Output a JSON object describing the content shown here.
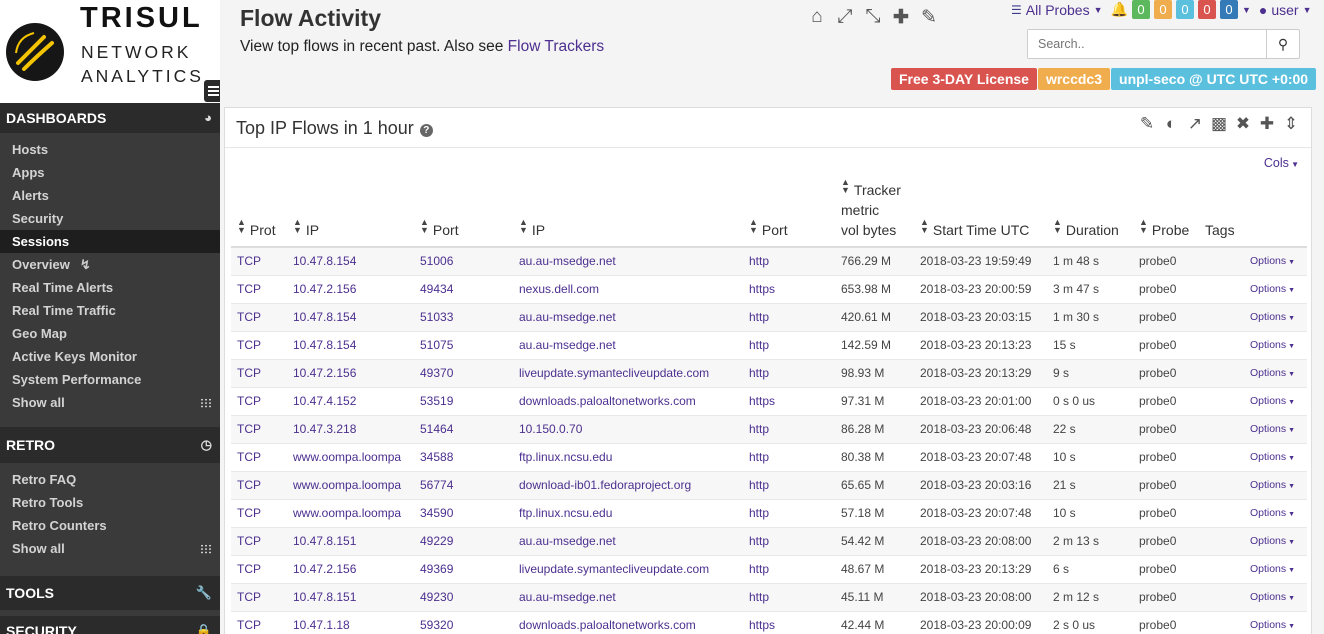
{
  "brand": {
    "name": "TRISUL",
    "line1": "NETWORK",
    "line2": "ANALYTICS"
  },
  "sidebar": {
    "dashboards": {
      "title": "DASHBOARDS",
      "items": [
        {
          "label": "Hosts"
        },
        {
          "label": "Apps"
        },
        {
          "label": "Alerts"
        },
        {
          "label": "Security"
        },
        {
          "label": "Sessions",
          "active": true
        },
        {
          "label": "Overview"
        },
        {
          "label": "Real Time Alerts"
        },
        {
          "label": "Real Time Traffic"
        },
        {
          "label": "Geo Map"
        },
        {
          "label": "Active Keys Monitor"
        },
        {
          "label": "System Performance"
        },
        {
          "label": "Show all"
        }
      ]
    },
    "retro": {
      "title": "RETRO",
      "items": [
        {
          "label": "Retro FAQ"
        },
        {
          "label": "Retro Tools"
        },
        {
          "label": "Retro Counters"
        },
        {
          "label": "Show all"
        }
      ]
    },
    "tools": {
      "title": "TOOLS"
    },
    "security": {
      "title": "SECURITY"
    }
  },
  "header": {
    "title": "Flow Activity",
    "subtitle": "View top flows in recent past. Also see",
    "subtitle_link": "Flow Trackers"
  },
  "topbar": {
    "probes_label": "All Probes",
    "counts": [
      {
        "value": "0",
        "color": "#5cb85c"
      },
      {
        "value": "0",
        "color": "#f0ad4e"
      },
      {
        "value": "0",
        "color": "#5bc0de"
      },
      {
        "value": "0",
        "color": "#d9534f"
      },
      {
        "value": "0",
        "color": "#337ab7"
      }
    ],
    "user_label": "user",
    "search_placeholder": "Search.."
  },
  "labels": [
    {
      "text": "Free 3-DAY License",
      "color": "#d9534f"
    },
    {
      "text": "wrccdc3",
      "color": "#f0ad4e"
    },
    {
      "text": "unpl-seco @ UTC UTC +0:00",
      "color": "#5bc0de"
    }
  ],
  "panel": {
    "title": "Top IP Flows in 1 hour",
    "cols_label": "Cols",
    "columns": {
      "prot": "Prot",
      "ip1": "IP",
      "port1": "Port",
      "ip2": "IP",
      "port2": "Port",
      "tracker1": "Tracker",
      "tracker2": "metric",
      "tracker3": "vol bytes",
      "start": "Start Time UTC",
      "duration": "Duration",
      "probe": "Probe",
      "tags": "Tags"
    },
    "rows": [
      {
        "prot": "TCP",
        "ip1": "10.47.8.154",
        "port1": "51006",
        "ip2": "au.au-msedge.net",
        "port2": "http",
        "tracker": "766.29 M",
        "start": "2018-03-23 19:59:49",
        "duration": "1 m 48 s",
        "probe": "probe0",
        "options": "Options"
      },
      {
        "prot": "TCP",
        "ip1": "10.47.2.156",
        "port1": "49434",
        "ip2": "nexus.dell.com",
        "port2": "https",
        "tracker": "653.98 M",
        "start": "2018-03-23 20:00:59",
        "duration": "3 m 47 s",
        "probe": "probe0",
        "options": "Options"
      },
      {
        "prot": "TCP",
        "ip1": "10.47.8.154",
        "port1": "51033",
        "ip2": "au.au-msedge.net",
        "port2": "http",
        "tracker": "420.61 M",
        "start": "2018-03-23 20:03:15",
        "duration": "1 m 30 s",
        "probe": "probe0",
        "options": "Options"
      },
      {
        "prot": "TCP",
        "ip1": "10.47.8.154",
        "port1": "51075",
        "ip2": "au.au-msedge.net",
        "port2": "http",
        "tracker": "142.59 M",
        "start": "2018-03-23 20:13:23",
        "duration": "15 s",
        "probe": "probe0",
        "options": "Options"
      },
      {
        "prot": "TCP",
        "ip1": "10.47.2.156",
        "port1": "49370",
        "ip2": "liveupdate.symantecliveupdate.com",
        "port2": "http",
        "tracker": "98.93 M",
        "start": "2018-03-23 20:13:29",
        "duration": "9 s",
        "probe": "probe0",
        "options": "Options"
      },
      {
        "prot": "TCP",
        "ip1": "10.47.4.152",
        "port1": "53519",
        "ip2": "downloads.paloaltonetworks.com",
        "port2": "https",
        "tracker": "97.31 M",
        "start": "2018-03-23 20:01:00",
        "duration": "0 s 0 us",
        "probe": "probe0",
        "options": "Options"
      },
      {
        "prot": "TCP",
        "ip1": "10.47.3.218",
        "port1": "51464",
        "ip2": "10.150.0.70",
        "port2": "http",
        "tracker": "86.28 M",
        "start": "2018-03-23 20:06:48",
        "duration": "22 s",
        "probe": "probe0",
        "options": "Options"
      },
      {
        "prot": "TCP",
        "ip1": "www.oompa.loompa",
        "port1": "34588",
        "ip2": "ftp.linux.ncsu.edu",
        "port2": "http",
        "tracker": "80.38 M",
        "start": "2018-03-23 20:07:48",
        "duration": "10 s",
        "probe": "probe0",
        "options": "Options"
      },
      {
        "prot": "TCP",
        "ip1": "www.oompa.loompa",
        "port1": "56774",
        "ip2": "download-ib01.fedoraproject.org",
        "port2": "http",
        "tracker": "65.65 M",
        "start": "2018-03-23 20:03:16",
        "duration": "21 s",
        "probe": "probe0",
        "options": "Options"
      },
      {
        "prot": "TCP",
        "ip1": "www.oompa.loompa",
        "port1": "34590",
        "ip2": "ftp.linux.ncsu.edu",
        "port2": "http",
        "tracker": "57.18 M",
        "start": "2018-03-23 20:07:48",
        "duration": "10 s",
        "probe": "probe0",
        "options": "Options"
      },
      {
        "prot": "TCP",
        "ip1": "10.47.8.151",
        "port1": "49229",
        "ip2": "au.au-msedge.net",
        "port2": "http",
        "tracker": "54.42 M",
        "start": "2018-03-23 20:08:00",
        "duration": "2 m 13 s",
        "probe": "probe0",
        "options": "Options"
      },
      {
        "prot": "TCP",
        "ip1": "10.47.2.156",
        "port1": "49369",
        "ip2": "liveupdate.symantecliveupdate.com",
        "port2": "http",
        "tracker": "48.67 M",
        "start": "2018-03-23 20:13:29",
        "duration": "6 s",
        "probe": "probe0",
        "options": "Options"
      },
      {
        "prot": "TCP",
        "ip1": "10.47.8.151",
        "port1": "49230",
        "ip2": "au.au-msedge.net",
        "port2": "http",
        "tracker": "45.11 M",
        "start": "2018-03-23 20:08:00",
        "duration": "2 m 12 s",
        "probe": "probe0",
        "options": "Options"
      },
      {
        "prot": "TCP",
        "ip1": "10.47.1.18",
        "port1": "59320",
        "ip2": "downloads.paloaltonetworks.com",
        "port2": "https",
        "tracker": "42.44 M",
        "start": "2018-03-23 20:00:09",
        "duration": "2 s 0 us",
        "probe": "probe0",
        "options": "Options"
      }
    ]
  }
}
